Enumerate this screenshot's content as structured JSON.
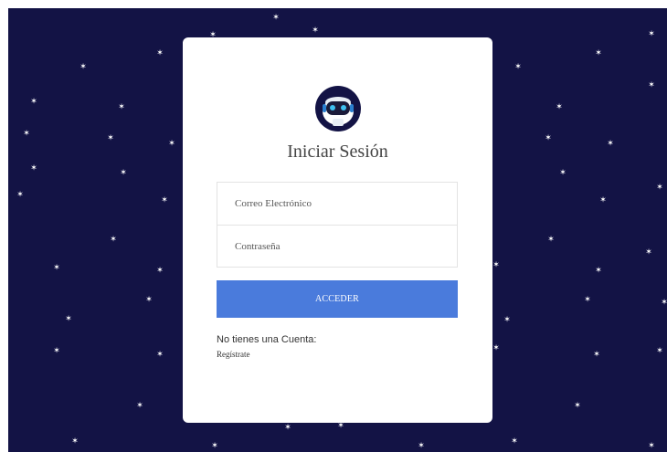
{
  "colors": {
    "background": "#131345",
    "card": "#ffffff",
    "accent_button": "#4a7bdc",
    "star": "#ffffff"
  },
  "star_glyph": "✶",
  "login": {
    "logo_icon": "robot-avatar-icon",
    "title": "Iniciar Sesión",
    "email_placeholder": "Correo Electrónico",
    "email_value": "",
    "password_placeholder": "Contraseña",
    "password_value": "",
    "submit_label": "ACCEDER",
    "no_account_text": "No tienes una Cuenta:",
    "register_link": "Regístrate"
  }
}
